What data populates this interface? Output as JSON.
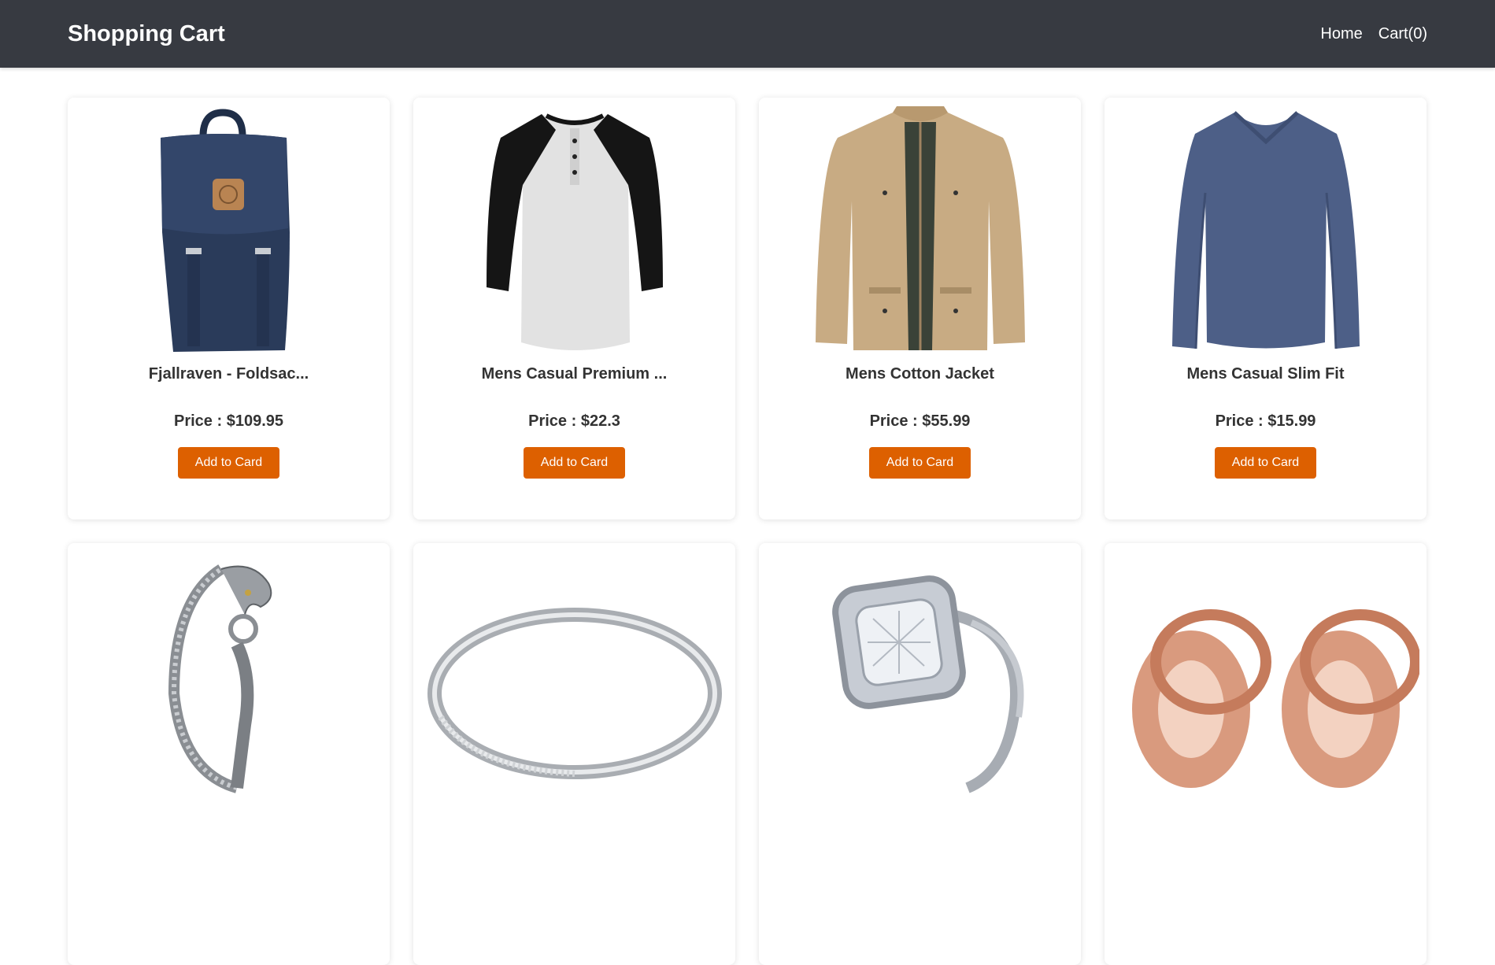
{
  "navbar": {
    "brand": "Shopping Cart",
    "links": [
      "Home",
      "Cart(0)"
    ]
  },
  "products": [
    {
      "title": "Fjallraven - Foldsac...",
      "price": "Price : $109.95",
      "button": "Add to Card",
      "image": "backpack"
    },
    {
      "title": "Mens Casual Premium ...",
      "price": "Price : $22.3",
      "button": "Add to Card",
      "image": "raglan-tshirt"
    },
    {
      "title": "Mens Cotton Jacket",
      "price": "Price : $55.99",
      "button": "Add to Card",
      "image": "jacket"
    },
    {
      "title": "Mens Casual Slim Fit",
      "price": "Price : $15.99",
      "button": "Add to Card",
      "image": "long-sleeve-shirt"
    },
    {
      "title": "",
      "price": "",
      "button": "",
      "image": "dragon-bracelet"
    },
    {
      "title": "",
      "price": "",
      "button": "",
      "image": "silver-ring"
    },
    {
      "title": "",
      "price": "",
      "button": "",
      "image": "diamond-ring"
    },
    {
      "title": "",
      "price": "",
      "button": "",
      "image": "rose-gold-plugs"
    }
  ],
  "colors": {
    "navbar": "#373a41",
    "button": "#dd6000"
  }
}
